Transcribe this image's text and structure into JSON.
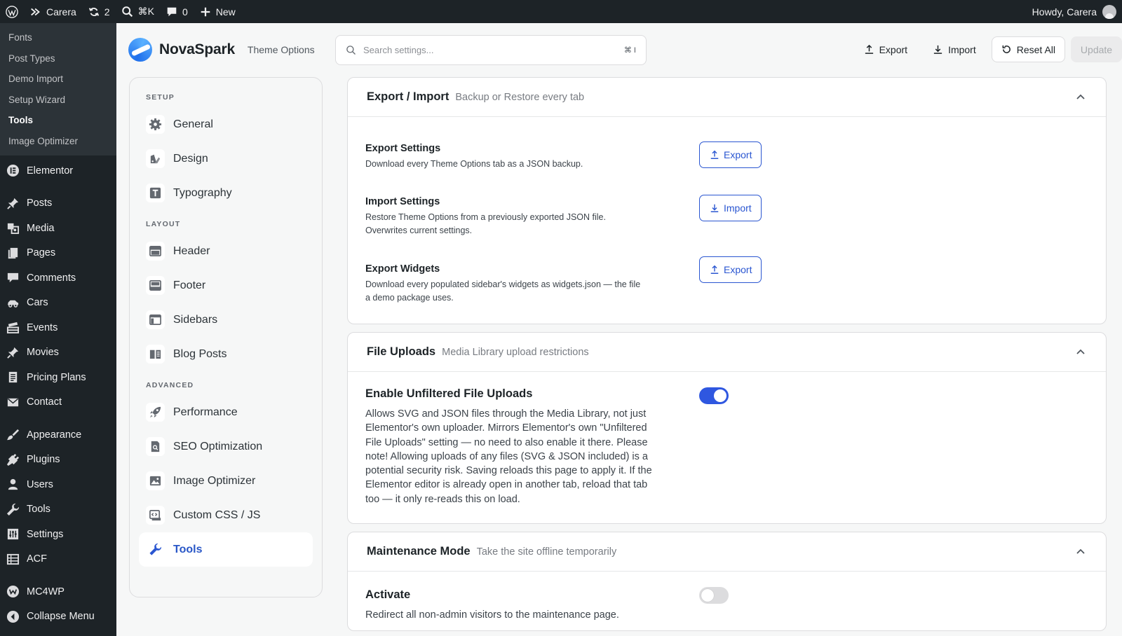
{
  "adminbar": {
    "site_name": "Carera",
    "updates_count": "2",
    "search_shortcut": "⌘K",
    "comments_count": "0",
    "new_label": "New",
    "greeting": "Howdy, Carera"
  },
  "adminmenu": {
    "submenu": [
      {
        "label": "Fonts",
        "current": false
      },
      {
        "label": "Post Types",
        "current": false
      },
      {
        "label": "Demo Import",
        "current": false
      },
      {
        "label": "Setup Wizard",
        "current": false
      },
      {
        "label": "Tools",
        "current": true
      },
      {
        "label": "Image Optimizer",
        "current": false
      }
    ],
    "items": [
      {
        "label": "Elementor",
        "icon": "elementor-icon"
      },
      {
        "label": "Posts",
        "icon": "pin-icon"
      },
      {
        "label": "Media",
        "icon": "media-icon"
      },
      {
        "label": "Pages",
        "icon": "pages-icon"
      },
      {
        "label": "Comments",
        "icon": "comment-icon"
      },
      {
        "label": "Cars",
        "icon": "car-icon"
      },
      {
        "label": "Events",
        "icon": "events-icon"
      },
      {
        "label": "Movies",
        "icon": "pin-icon"
      },
      {
        "label": "Pricing Plans",
        "icon": "document-icon"
      },
      {
        "label": "Contact",
        "icon": "mail-icon"
      },
      {
        "label": "Appearance",
        "icon": "brush-icon"
      },
      {
        "label": "Plugins",
        "icon": "plugin-icon"
      },
      {
        "label": "Users",
        "icon": "user-icon"
      },
      {
        "label": "Tools",
        "icon": "wrench-icon"
      },
      {
        "label": "Settings",
        "icon": "settings-icon"
      },
      {
        "label": "ACF",
        "icon": "table-icon"
      },
      {
        "label": "MC4WP",
        "icon": "mc4wp-icon"
      },
      {
        "label": "Collapse Menu",
        "icon": "collapse-icon"
      }
    ]
  },
  "brand": {
    "name": "NovaSpark",
    "subtitle": "Theme Options"
  },
  "search": {
    "placeholder": "Search settings...",
    "shortcut": "⌘ I"
  },
  "toolbar": {
    "export_label": "Export",
    "import_label": "Import",
    "reset_label": "Reset All",
    "update_label": "Update"
  },
  "sidebar": {
    "sections": [
      {
        "title": "SETUP",
        "items": [
          {
            "label": "General",
            "icon": "gear-icon"
          },
          {
            "label": "Design",
            "icon": "design-icon"
          },
          {
            "label": "Typography",
            "icon": "typography-icon"
          }
        ]
      },
      {
        "title": "LAYOUT",
        "items": [
          {
            "label": "Header",
            "icon": "header-icon"
          },
          {
            "label": "Footer",
            "icon": "footer-icon"
          },
          {
            "label": "Sidebars",
            "icon": "sidebars-icon"
          },
          {
            "label": "Blog Posts",
            "icon": "book-icon"
          }
        ]
      },
      {
        "title": "ADVANCED",
        "items": [
          {
            "label": "Performance",
            "icon": "rocket-icon"
          },
          {
            "label": "SEO Optimization",
            "icon": "seo-icon"
          },
          {
            "label": "Image Optimizer",
            "icon": "image-icon"
          },
          {
            "label": "Custom CSS / JS",
            "icon": "code-icon"
          },
          {
            "label": "Tools",
            "icon": "wrench-icon",
            "active": true
          }
        ]
      }
    ]
  },
  "panels": {
    "export_import": {
      "title": "Export / Import",
      "subtitle": "Backup or Restore every tab",
      "rows": [
        {
          "title": "Export Settings",
          "desc": "Download every Theme Options tab as a JSON backup.",
          "button": "Export",
          "kind": "export"
        },
        {
          "title": "Import Settings",
          "desc": "Restore Theme Options from a previously exported JSON file. Overwrites current settings.",
          "button": "Import",
          "kind": "import"
        },
        {
          "title": "Export Widgets",
          "desc": "Download every populated sidebar's widgets as widgets.json — the file a demo package uses.",
          "button": "Export",
          "kind": "export"
        }
      ]
    },
    "file_uploads": {
      "title": "File Uploads",
      "subtitle": "Media Library upload restrictions",
      "setting_title": "Enable Unfiltered File Uploads",
      "setting_desc": "Allows SVG and JSON files through the Media Library, not just Elementor's own uploader. Mirrors Elementor's own \"Unfiltered File Uploads\" setting — no need to also enable it there. Please note! Allowing uploads of any files (SVG & JSON included) is a potential security risk. Saving reloads this page to apply it. If the Elementor editor is already open in another tab, reload that tab too — it only re-reads this on load.",
      "enabled": true
    },
    "maintenance": {
      "title": "Maintenance Mode",
      "subtitle": "Take the site offline temporarily",
      "setting_title": "Activate",
      "setting_desc": "Redirect all non-admin visitors to the maintenance page.",
      "enabled": false
    }
  },
  "colors": {
    "accent": "#2a56d1",
    "toggle_on": "#2f57e0",
    "admin_bg": "#1d2327"
  }
}
